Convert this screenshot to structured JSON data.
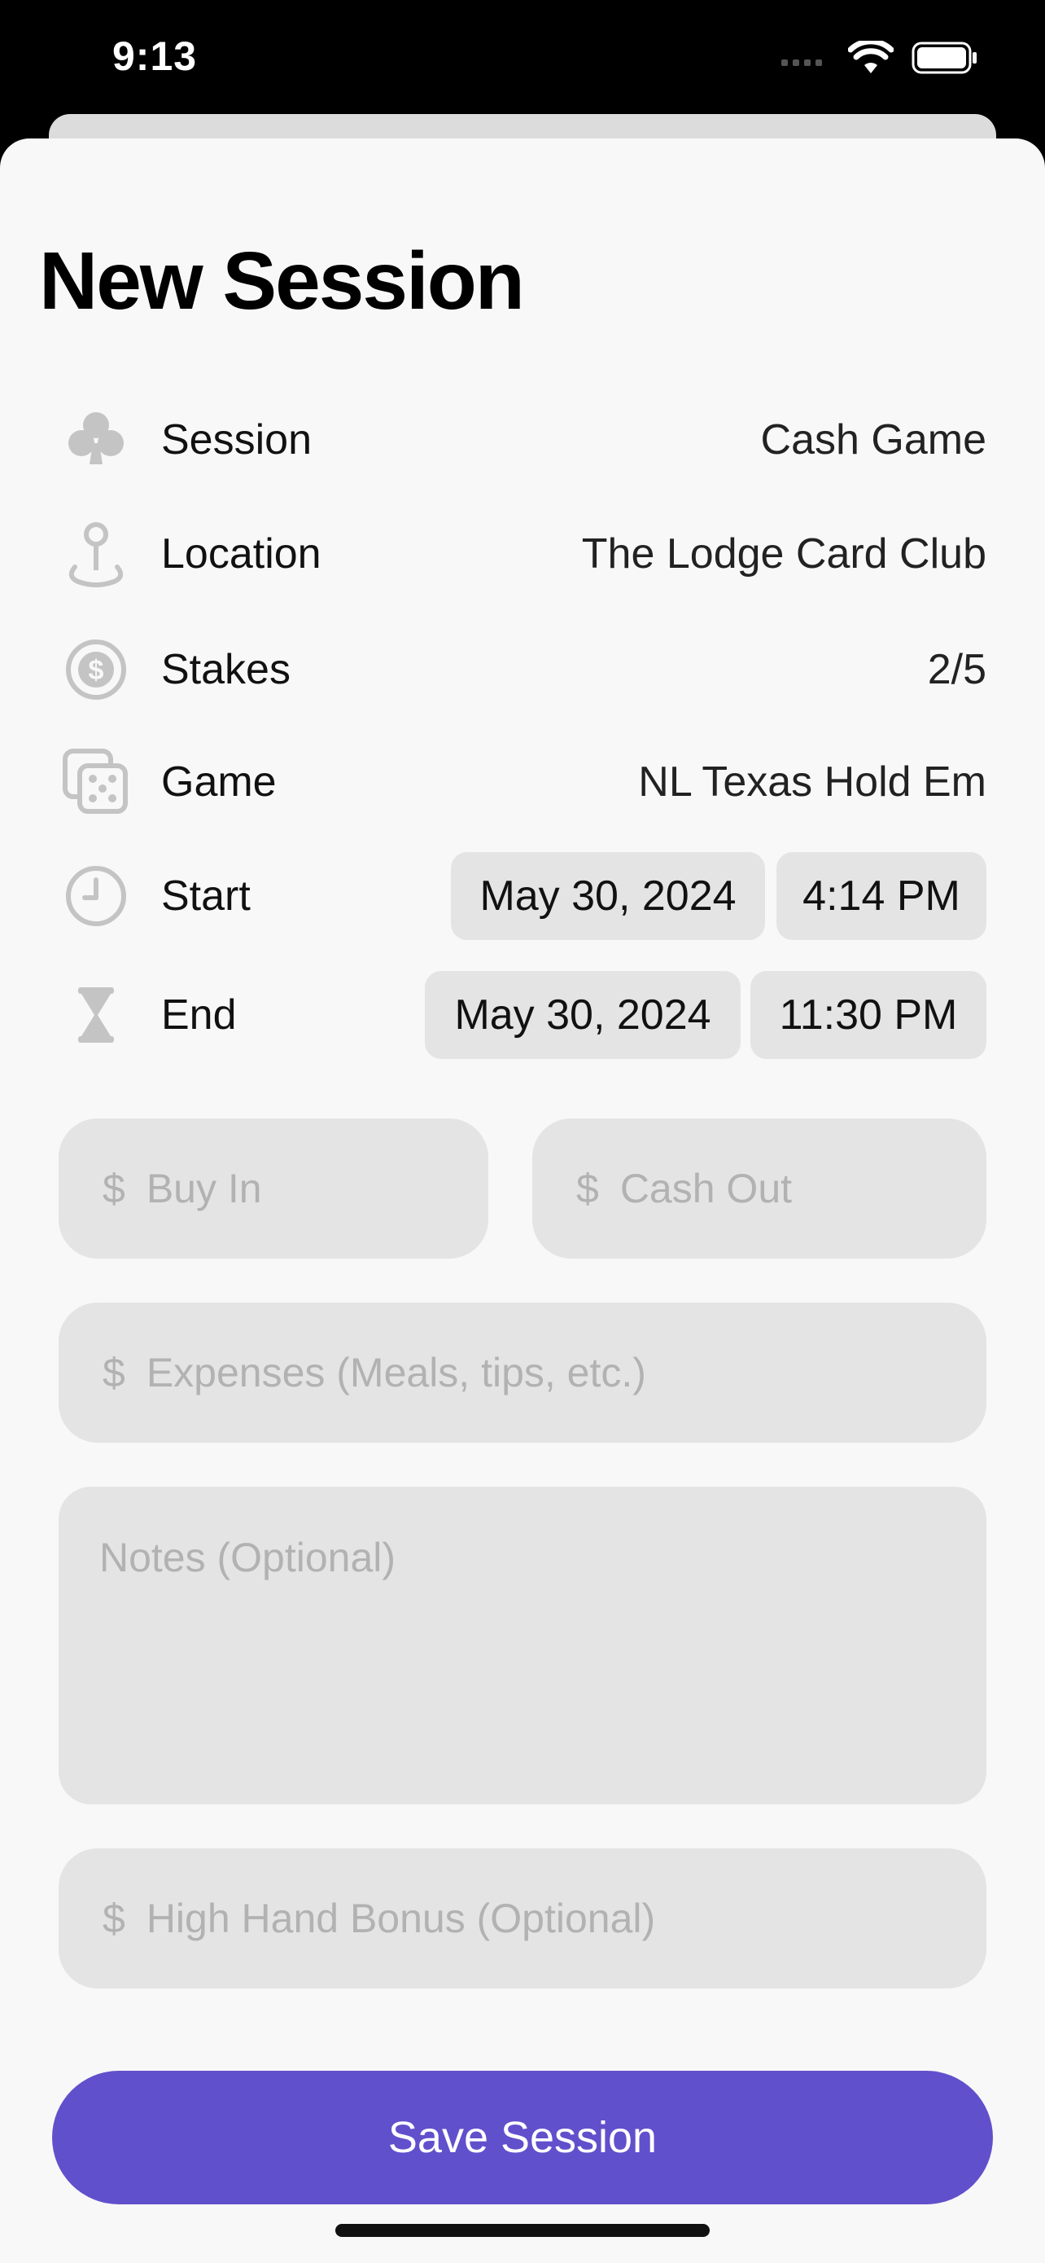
{
  "status_bar": {
    "time": "9:13"
  },
  "sheet": {
    "title": "New Session"
  },
  "rows": {
    "session": {
      "label": "Session",
      "value": "Cash Game",
      "icon": "club-icon"
    },
    "location": {
      "label": "Location",
      "value": "The Lodge Card Club",
      "icon": "location-pin-icon"
    },
    "stakes": {
      "label": "Stakes",
      "value": "2/5",
      "icon": "dollar-circle-icon"
    },
    "game": {
      "label": "Game",
      "value": "NL Texas Hold Em",
      "icon": "dice-icon"
    },
    "start": {
      "label": "Start",
      "date": "May 30, 2024",
      "time": "4:14 PM",
      "icon": "clock-icon"
    },
    "end": {
      "label": "End",
      "date": "May 30, 2024",
      "time": "11:30 PM",
      "icon": "hourglass-icon"
    }
  },
  "fields": {
    "currency_symbol": "$",
    "buy_in_placeholder": "Buy In",
    "cash_out_placeholder": "Cash Out",
    "expenses_placeholder": "Expenses (Meals, tips, etc.)",
    "notes_placeholder": "Notes (Optional)",
    "high_hand_placeholder": "High Hand Bonus (Optional)"
  },
  "save_button": {
    "label": "Save Session"
  },
  "colors": {
    "accent": "#6150cc",
    "sheet_background": "#f8f8f8",
    "field_background": "#e4e4e4",
    "placeholder_text": "#b2b2b2",
    "icon_gray": "#c4c4c4"
  }
}
